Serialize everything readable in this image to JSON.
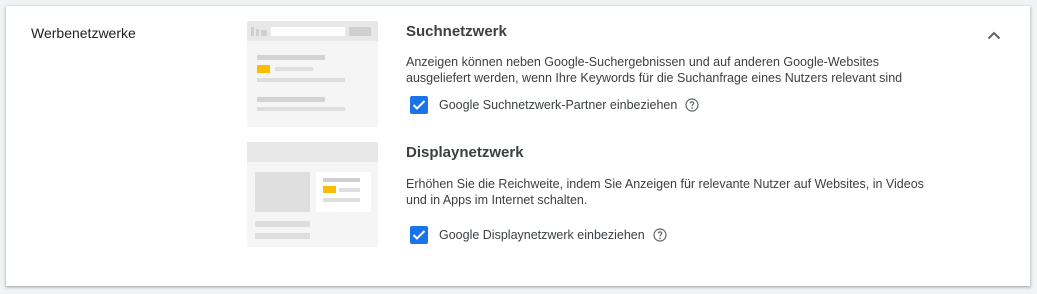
{
  "section": {
    "label": "Werbenetzwerke"
  },
  "networks": [
    {
      "title": "Suchnetzwerk",
      "description_line1": "Anzeigen können neben Google-Suchergebnissen und auf anderen Google-Websites",
      "description_line2": "ausgeliefert werden, wenn Ihre Keywords für die Suchanfrage eines Nutzers relevant sind",
      "checkbox_label": "Google Suchnetzwerk-Partner einbeziehen",
      "checked": true
    },
    {
      "title": "Displaynetzwerk",
      "description_line1": "Erhöhen Sie die Reichweite, indem Sie Anzeigen für relevante Nutzer auf Websites, in Videos",
      "description_line2": "und in Apps im Internet schalten.",
      "checkbox_label": "Google Displaynetzwerk einbeziehen",
      "checked": true
    }
  ],
  "icons": {
    "collapse": "chevron-up-icon",
    "help": "help-circle-icon",
    "check": "check-icon"
  },
  "colors": {
    "accent": "#1a73e8",
    "ad_highlight": "#fbbc04"
  }
}
